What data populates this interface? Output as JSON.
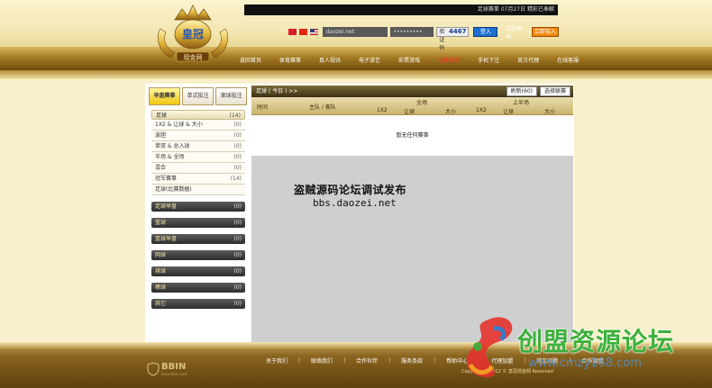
{
  "topbar": {
    "marquee": "足球赛事 07月27日 精彩已奉献"
  },
  "login": {
    "username": "daozei.net",
    "password": "•••••••••",
    "captcha_code": "4467",
    "captcha_label": "验证码",
    "login_label": "登入",
    "forgot_label": "忘记密码",
    "join_label": "立即加入"
  },
  "nav": [
    {
      "label": "返回首页"
    },
    {
      "label": "体育赛事"
    },
    {
      "label": "真人视讯"
    },
    {
      "label": "电子游艺"
    },
    {
      "label": "彩票游戏"
    },
    {
      "label": "优惠活动"
    },
    {
      "label": "手机下注"
    },
    {
      "label": "官方代理"
    },
    {
      "label": "在线客服"
    }
  ],
  "sidebar": {
    "tabs": [
      {
        "label": "早盘赛事"
      },
      {
        "label": "单式投注"
      },
      {
        "label": "滚球投注"
      }
    ],
    "open_category": {
      "label": "足球",
      "count": "(14)"
    },
    "sub_items": [
      {
        "label": "1X2 & 让球 & 大小",
        "count": "(0)"
      },
      {
        "label": "波胆",
        "count": "(0)"
      },
      {
        "label": "单双 & 总入球",
        "count": "(0)"
      },
      {
        "label": "半场 & 全场",
        "count": "(0)"
      },
      {
        "label": "混合",
        "count": "(0)"
      },
      {
        "label": "冠军赛事",
        "count": "(14)"
      },
      {
        "label": "足球(比赛数据)",
        "count": ""
      }
    ],
    "categories": [
      {
        "label": "足球早盘",
        "count": "(0)"
      },
      {
        "label": "篮球",
        "count": "(0)"
      },
      {
        "label": "篮球早盘",
        "count": "(0)"
      },
      {
        "label": "网球",
        "count": "(0)"
      },
      {
        "label": "排球",
        "count": "(0)"
      },
      {
        "label": "棒球",
        "count": "(0)"
      },
      {
        "label": "其它",
        "count": "(0)"
      }
    ]
  },
  "panel": {
    "title": "足球 ( 今日 ) >>",
    "refresh_label": "刷新(60)",
    "league_label": "选择联赛",
    "headers": {
      "time": "时间",
      "teams": "主队 / 客队",
      "full_time": "全场",
      "half_time": "上半场",
      "ft_1x2": "1X2",
      "ft_handicap": "让球",
      "ft_ou": "大小",
      "ht_1x2": "1X2",
      "ht_handicap": "让球",
      "ht_ou": "大小"
    },
    "empty_message": "暂无任何赛事"
  },
  "watermark": {
    "text": "盗贼源码论坛调试发布",
    "url": "bbs.daozei.net"
  },
  "footer": {
    "links": [
      {
        "label": "关于我们"
      },
      {
        "label": "联络我们"
      },
      {
        "label": "合作伙伴"
      },
      {
        "label": "服务条款"
      },
      {
        "label": "帮助中心"
      },
      {
        "label": "代理加盟"
      },
      {
        "label": "常见问题"
      },
      {
        "label": "合作加盟"
      }
    ],
    "copyright": "Copyright ©2012 © 皇冠现金网 Reserved",
    "bbin_logo": "BBIN",
    "bbin_sub": "www.bbin.com"
  },
  "overlay": {
    "brand": "创盟资源论坛",
    "url": "www.cmzy168.com"
  },
  "logo": {
    "text": "皇冠",
    "sub": "现金网"
  },
  "colors": {
    "accent_gold": "#a57b22",
    "nav_active": "#ff3030",
    "login_blue": "#1f6fd0",
    "join_orange": "#f08a10"
  }
}
